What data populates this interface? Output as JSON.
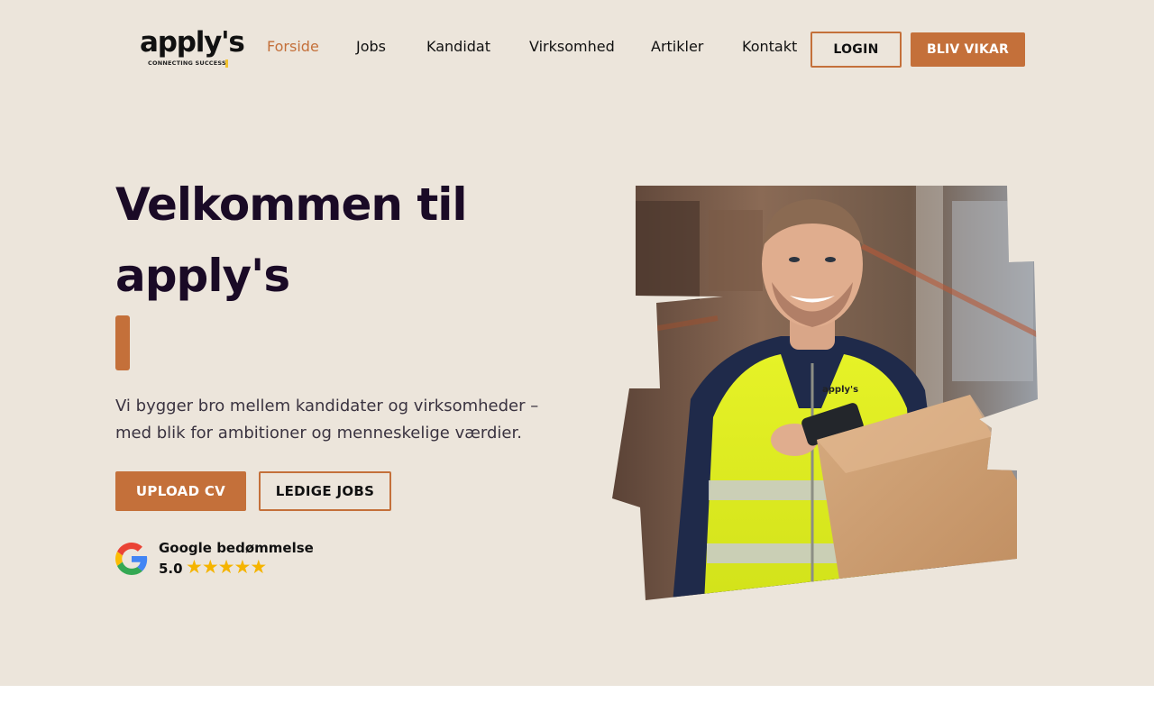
{
  "brand": {
    "name": "apply's",
    "tagline": "CONNECTING SUCCESS",
    "accent": "#c4703a",
    "background": "#ece5db",
    "heading_color": "#1a0a26"
  },
  "nav": {
    "items": [
      {
        "label": "Forside",
        "active": true
      },
      {
        "label": "Jobs",
        "active": false
      },
      {
        "label": "Kandidat",
        "active": false
      },
      {
        "label": "Virksomhed",
        "active": false
      },
      {
        "label": "Artikler",
        "active": false
      },
      {
        "label": "Kontakt",
        "active": false
      }
    ],
    "login_label": "LOGIN",
    "cta_label": "BLIV VIKAR"
  },
  "hero": {
    "title_line1": "Velkommen til",
    "title_line2": "apply's",
    "subtitle_line1": "Vi bygger bro mellem kandidater og virksomheder –",
    "subtitle_line2": "med blik for ambitioner og menneskelige værdier.",
    "primary_button": "UPLOAD CV",
    "secondary_button": "LEDIGE JOBS",
    "vest_print": "apply's"
  },
  "rating": {
    "label": "Google bedømmelse",
    "score": "5.0",
    "stars": 5,
    "icon": "google-icon"
  }
}
